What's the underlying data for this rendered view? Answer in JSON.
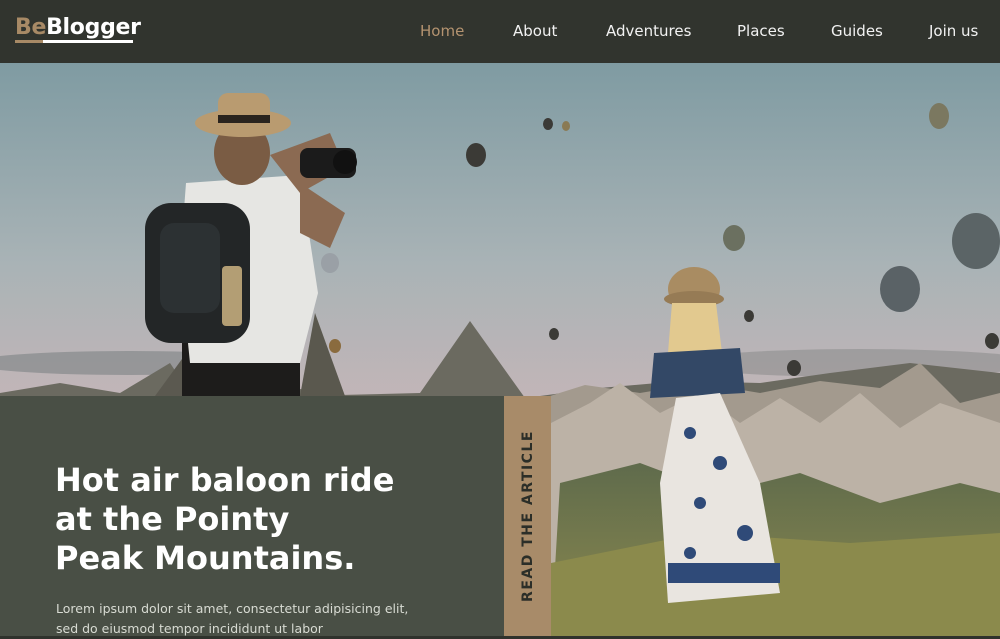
{
  "brand": {
    "prefix": "Be",
    "name": "Blogger"
  },
  "nav": {
    "items": [
      {
        "label": "Home",
        "active": true
      },
      {
        "label": "About",
        "active": false
      },
      {
        "label": "Adventures",
        "active": false
      },
      {
        "label": "Places",
        "active": false
      },
      {
        "label": "Guides",
        "active": false
      },
      {
        "label": "Join us",
        "active": false
      }
    ]
  },
  "hero": {
    "image_subject": "hero-photo"
  },
  "article": {
    "title": "Hot air baloon ride\nat the Pointy\nPeak Mountains.",
    "excerpt": "Lorem ipsum dolor sit amet, consectetur adipisicing elit,\nsed do eiusmod tempor incididunt ut labor",
    "cta_label": "READ THE ARTICLE"
  },
  "colors": {
    "header_bg": "#31342e",
    "accent": "#a88b69",
    "nav_active": "#b49370",
    "card_bg": "#494f45"
  }
}
